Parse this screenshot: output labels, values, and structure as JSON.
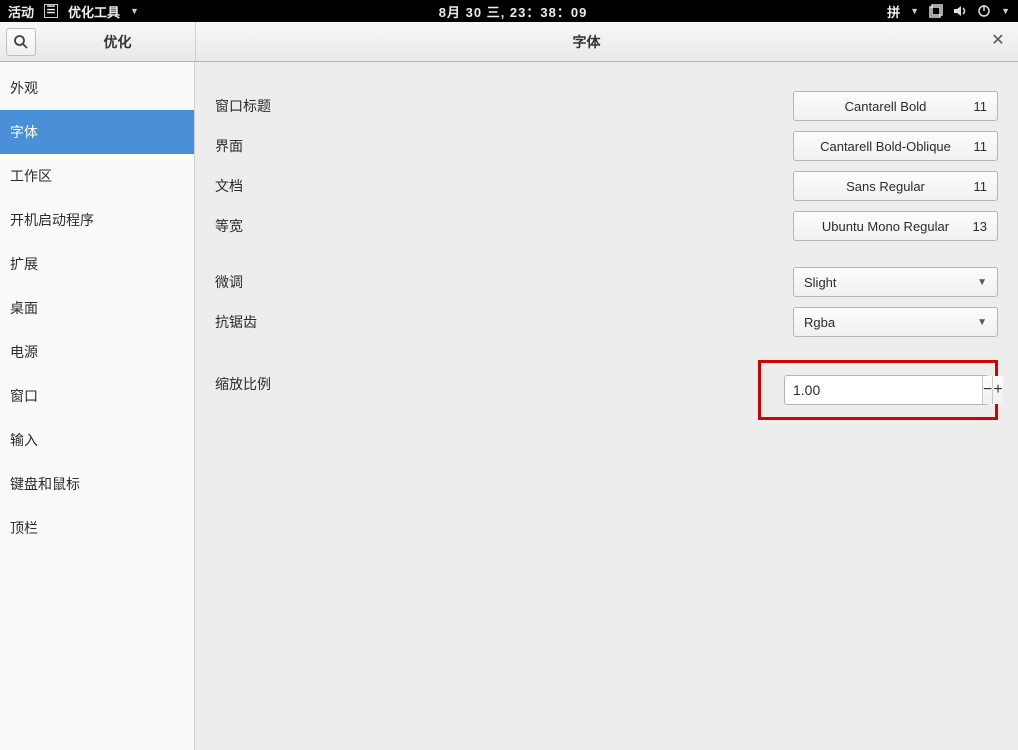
{
  "topbar": {
    "activities": "活动",
    "app_name": "优化工具",
    "datetime": "8月 30 三, 23：38：09",
    "input_method": "拼"
  },
  "window": {
    "sidebar_title": "优化",
    "main_title": "字体"
  },
  "sidebar": {
    "items": [
      {
        "label": "外观",
        "active": false
      },
      {
        "label": "字体",
        "active": true
      },
      {
        "label": "工作区",
        "active": false
      },
      {
        "label": "开机启动程序",
        "active": false
      },
      {
        "label": "扩展",
        "active": false
      },
      {
        "label": "桌面",
        "active": false
      },
      {
        "label": "电源",
        "active": false
      },
      {
        "label": "窗口",
        "active": false
      },
      {
        "label": "输入",
        "active": false
      },
      {
        "label": "键盘和鼠标",
        "active": false
      },
      {
        "label": "顶栏",
        "active": false
      }
    ]
  },
  "fonts": {
    "window_titles": {
      "label": "窗口标题",
      "font": "Cantarell Bold",
      "size": "11"
    },
    "interface": {
      "label": "界面",
      "font": "Cantarell Bold-Oblique",
      "size": "11"
    },
    "documents": {
      "label": "文档",
      "font": "Sans Regular",
      "size": "11"
    },
    "monospace": {
      "label": "等宽",
      "font": "Ubuntu Mono Regular",
      "size": "13"
    }
  },
  "hinting": {
    "label": "微调",
    "value": "Slight"
  },
  "antialiasing": {
    "label": "抗锯齿",
    "value": "Rgba"
  },
  "scaling": {
    "label": "缩放比例",
    "value": "1.00"
  }
}
